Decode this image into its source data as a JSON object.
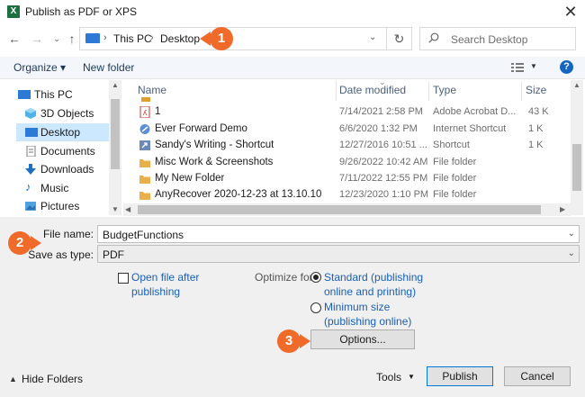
{
  "window": {
    "title": "Publish as PDF or XPS",
    "app_icon": "excel-icon"
  },
  "address": {
    "crumbs": [
      "This PC",
      "Desktop"
    ],
    "search_placeholder": "Search Desktop"
  },
  "toolbar": {
    "organize": "Organize ▾",
    "new_folder": "New folder"
  },
  "nav": {
    "items": [
      {
        "label": "This PC",
        "icon": "pc-icon"
      },
      {
        "label": "3D Objects",
        "icon": "cube-icon"
      },
      {
        "label": "Desktop",
        "icon": "desktop-icon"
      },
      {
        "label": "Documents",
        "icon": "document-icon"
      },
      {
        "label": "Downloads",
        "icon": "download-icon"
      },
      {
        "label": "Music",
        "icon": "music-icon"
      },
      {
        "label": "Pictures",
        "icon": "picture-icon"
      }
    ]
  },
  "files": {
    "columns": {
      "name": "Name",
      "date": "Date modified",
      "type": "Type",
      "size": "Size"
    },
    "rows": [
      {
        "name": "1",
        "date": "7/14/2021 2:58 PM",
        "type": "Adobe Acrobat D...",
        "size": "43 K",
        "icon": "pdf-icon"
      },
      {
        "name": "Ever Forward Demo",
        "date": "6/6/2020 1:32 PM",
        "type": "Internet Shortcut",
        "size": "1 K",
        "icon": "web-shortcut-icon"
      },
      {
        "name": "Sandy's Writing - Shortcut",
        "date": "12/27/2016 10:51 ...",
        "type": "Shortcut",
        "size": "1 K",
        "icon": "shortcut-icon"
      },
      {
        "name": "Misc Work & Screenshots",
        "date": "9/26/2022 10:42 AM",
        "type": "File folder",
        "size": "",
        "icon": "folder-icon"
      },
      {
        "name": "My New Folder",
        "date": "7/11/2022 12:55 PM",
        "type": "File folder",
        "size": "",
        "icon": "folder-icon"
      },
      {
        "name": "AnyRecover 2020-12-23 at 13.10.10",
        "date": "12/23/2020 1:10 PM",
        "type": "File folder",
        "size": "",
        "icon": "folder-icon"
      }
    ]
  },
  "form": {
    "file_name_label": "File name:",
    "file_name_value": "BudgetFunctions",
    "save_type_label": "Save as type:",
    "save_type_value": "PDF",
    "open_after_line1": "Open file after",
    "open_after_line2": "publishing",
    "optimize_label": "Optimize for:",
    "standard_line1": "Standard (publishing",
    "standard_line2": "online and printing)",
    "minimum_line1": "Minimum size",
    "minimum_line2": "(publishing online)",
    "options_button": "Options..."
  },
  "footer": {
    "hide_folders": "Hide Folders",
    "tools": "Tools",
    "publish": "Publish",
    "cancel": "Cancel"
  },
  "callouts": [
    "1",
    "2",
    "3"
  ],
  "colors": {
    "callout": "#f06a2a",
    "accent": "#0078d7",
    "selected": "#cce8ff"
  }
}
